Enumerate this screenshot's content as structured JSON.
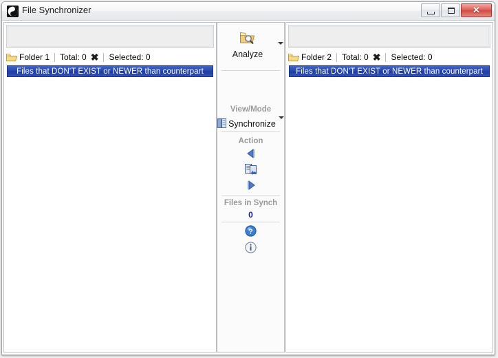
{
  "window": {
    "title": "File Synchronizer",
    "app_icon": "yinyang-icon",
    "controls": {
      "minimize": "minimize-button",
      "maximize": "maximize-button",
      "close_glyph": "✕"
    }
  },
  "panels": {
    "left": {
      "folder_label": "Folder 1",
      "total_label": "Total: 0",
      "clear_glyph": "✖",
      "selected_label": "Selected: 0",
      "banner": "Files that DON'T EXIST or NEWER than counterpart",
      "path_value": "",
      "path_placeholder": ""
    },
    "right": {
      "folder_label": "Folder 2",
      "total_label": "Total: 0",
      "clear_glyph": "✖",
      "selected_label": "Selected: 0",
      "banner": "Files that DON'T EXIST or NEWER than counterpart",
      "path_value": "",
      "path_placeholder": ""
    }
  },
  "center": {
    "analyze_label": "Analyze",
    "viewmode_title": "View/Mode",
    "viewmode_value": "Synchronize",
    "action_title": "Action",
    "files_in_synch_title": "Files in Synch",
    "files_in_synch_count": "0",
    "icons": {
      "analyze": "folder-search-icon",
      "viewmode": "list-mode-icon",
      "copy_left": "arrow-left-icon",
      "sync_both": "sync-files-icon",
      "copy_right": "arrow-right-icon",
      "help": "help-circle-icon",
      "info": "info-circle-icon"
    }
  },
  "colors": {
    "banner_blue": "#2a49ad",
    "count_blue": "#1b1e8c",
    "close_red": "#cf4b43",
    "folder_yellow": "#f5c962",
    "label_gray": "#9a9a9a"
  }
}
